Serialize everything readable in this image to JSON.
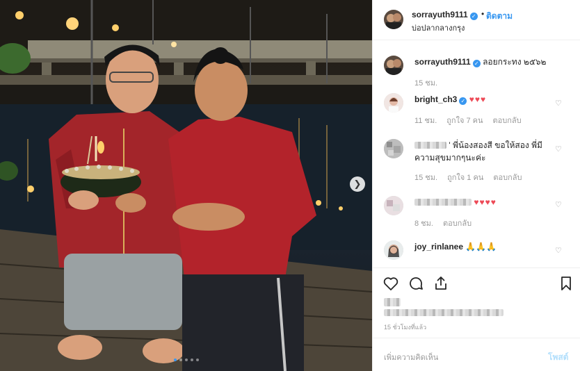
{
  "post": {
    "username": "sorrayuth9111",
    "follow_sep": "•",
    "follow_label": "ติดตาม",
    "location": "บ่อปลากลางกรุง",
    "caption": "ลอยกระทง ๒๕๖๒",
    "caption_time": "15 ชม.",
    "time_ago": "15 ชั่วโมงที่แล้ว"
  },
  "comments": [
    {
      "username": "bright_ch3",
      "text": "♥♥♥",
      "time": "11 ชม.",
      "likes": "ถูกใจ 7 คน",
      "reply": "ตอบกลับ"
    },
    {
      "username": "",
      "text": "' พี่น้องสองสี ขอให้สอง พี่มีความสุขมากๆนะค่ะ",
      "time": "15 ชม.",
      "likes": "ถูกใจ 1 คน",
      "reply": "ตอบกลับ"
    },
    {
      "username": "",
      "text": "♥♥♥♥",
      "time": "8 ชม.",
      "likes": "",
      "reply": "ตอบกลับ"
    },
    {
      "username": "joy_rinlanee",
      "text": "🙏🙏🙏",
      "time": "",
      "likes": "",
      "reply": ""
    }
  ],
  "add_comment": {
    "placeholder": "เพิ่มความคิดเห็น",
    "post_label": "โพสต์"
  },
  "carousel": {
    "total_slides": 5,
    "active_slide": 1
  },
  "icons": {
    "verified": "verified-badge-icon",
    "like": "heart-outline-icon",
    "comment": "speech-bubble-icon",
    "share": "share-arrow-icon",
    "save": "bookmark-icon",
    "next": "chevron-right-icon"
  },
  "colors": {
    "link": "#3897f0",
    "heart": "#ed4956",
    "muted": "#999999",
    "post_disabled": "#b2dffc"
  }
}
